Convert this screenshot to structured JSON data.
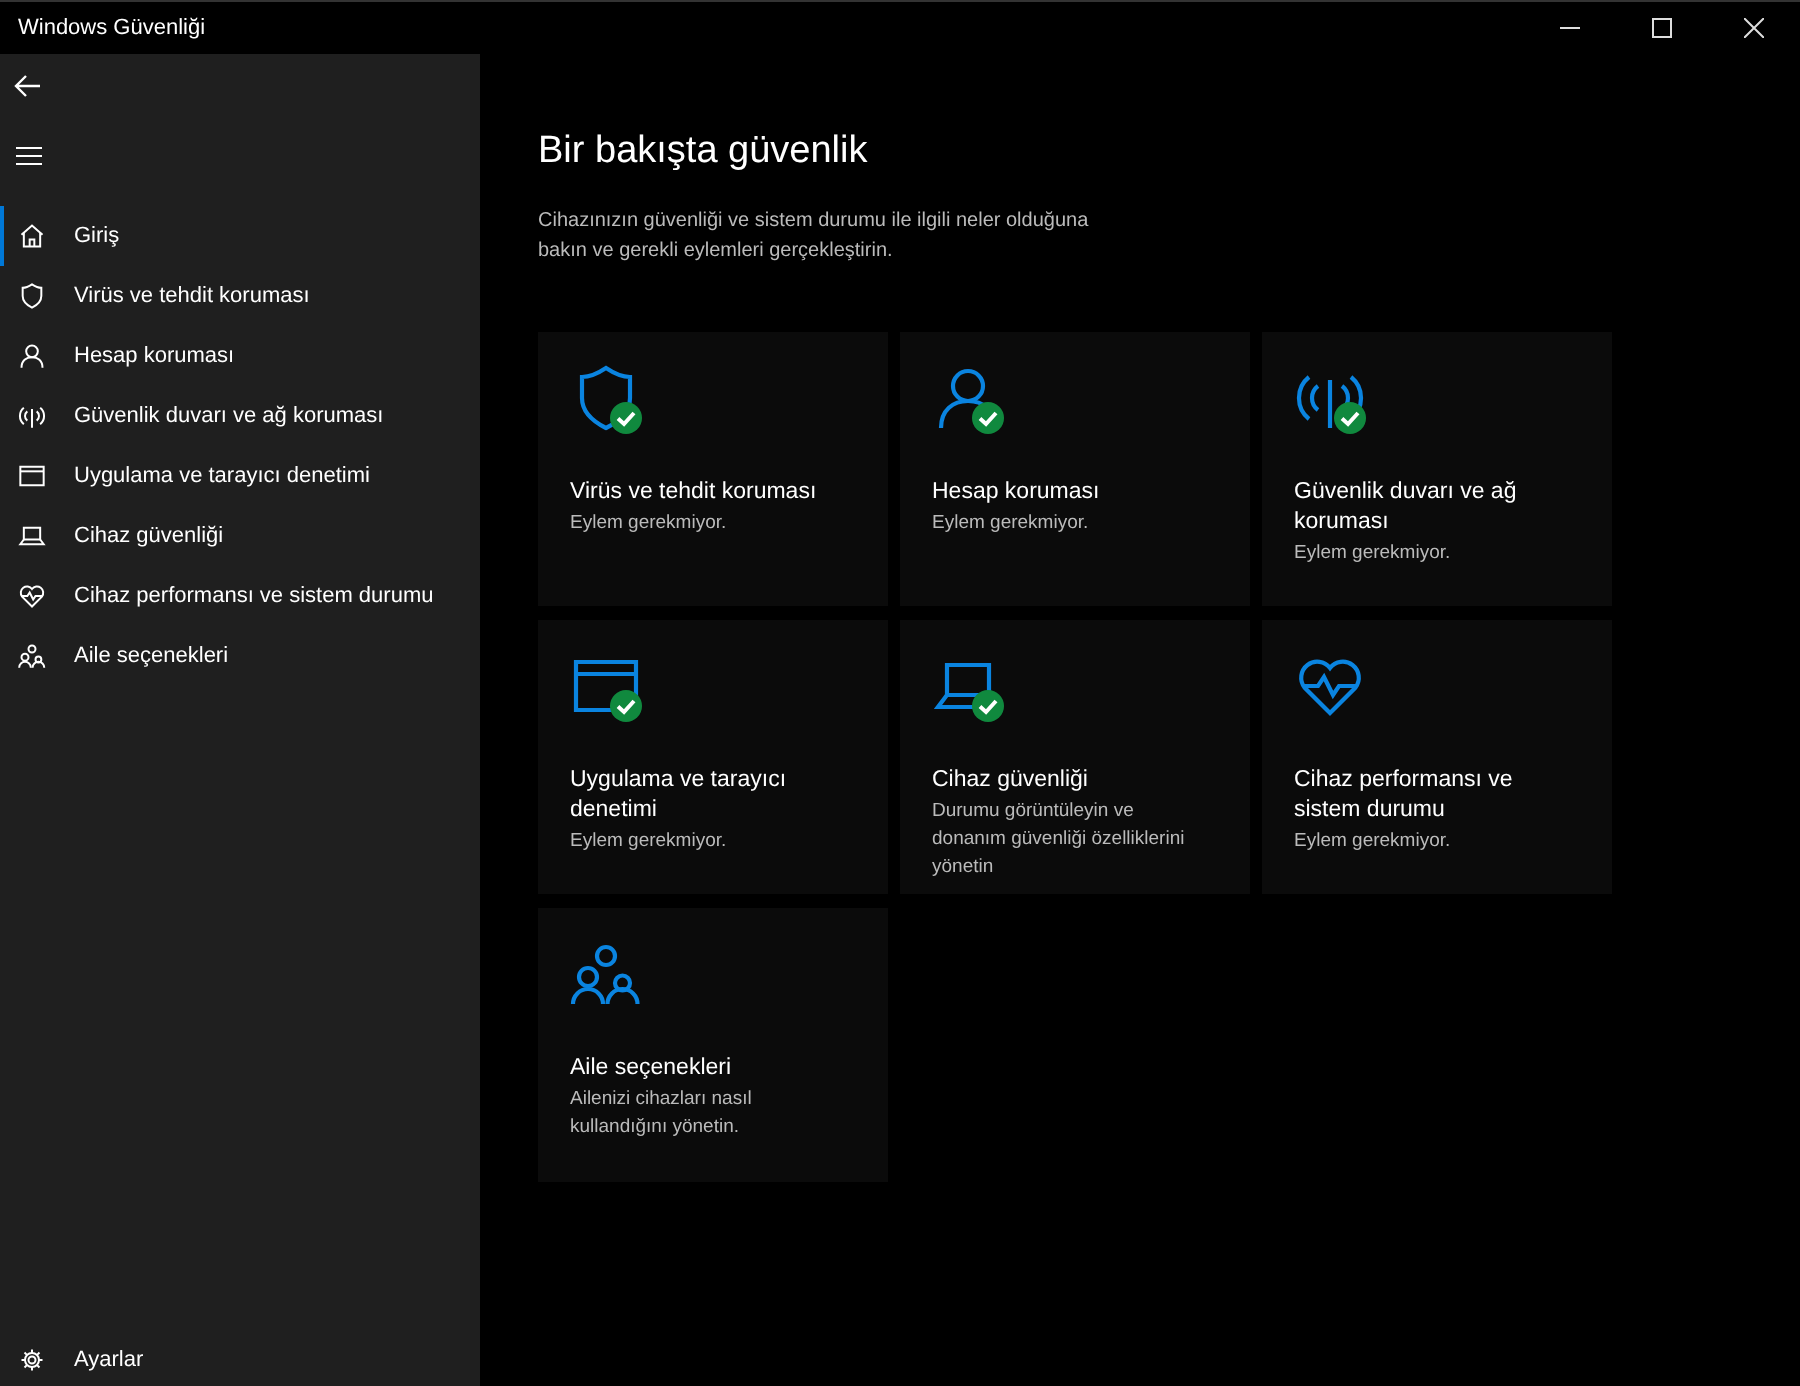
{
  "window": {
    "title": "Windows Güvenliği"
  },
  "sidebar": {
    "items": [
      {
        "label": "Giriş",
        "kind": "home",
        "selected": true
      },
      {
        "label": "Virüs ve tehdit koruması",
        "kind": "shield",
        "selected": false
      },
      {
        "label": "Hesap koruması",
        "kind": "person",
        "selected": false
      },
      {
        "label": "Güvenlik duvarı ve ağ koruması",
        "kind": "antenna",
        "selected": false
      },
      {
        "label": "Uygulama ve tarayıcı denetimi",
        "kind": "window",
        "selected": false
      },
      {
        "label": "Cihaz güvenliği",
        "kind": "laptop",
        "selected": false
      },
      {
        "label": "Cihaz performansı ve sistem durumu",
        "kind": "heart",
        "selected": false
      },
      {
        "label": "Aile seçenekleri",
        "kind": "family",
        "selected": false
      }
    ],
    "footer": {
      "label": "Ayarlar",
      "kind": "gear"
    }
  },
  "main": {
    "title": "Bir bakışta güvenlik",
    "description": "Cihazınızın güvenliği ve sistem durumu ile ilgili neler olduğuna bakın ve gerekli eylemleri gerçekleştirin.",
    "cards": [
      {
        "kind": "shield",
        "ok": true,
        "title": "Virüs ve tehdit koruması",
        "subtitle": "Eylem gerekmiyor."
      },
      {
        "kind": "person",
        "ok": true,
        "title": "Hesap koruması",
        "subtitle": "Eylem gerekmiyor."
      },
      {
        "kind": "antenna",
        "ok": true,
        "title": "Güvenlik duvarı ve ağ koruması",
        "subtitle": "Eylem gerekmiyor."
      },
      {
        "kind": "window",
        "ok": true,
        "title": "Uygulama ve tarayıcı denetimi",
        "subtitle": "Eylem gerekmiyor."
      },
      {
        "kind": "laptop",
        "ok": true,
        "title": "Cihaz güvenliği",
        "subtitle": "Durumu görüntüleyin ve donanım güvenliği özelliklerini yönetin"
      },
      {
        "kind": "heart",
        "ok": false,
        "title": "Cihaz performansı ve sistem durumu",
        "subtitle": "Eylem gerekmiyor."
      },
      {
        "kind": "family",
        "ok": false,
        "title": "Aile seçenekleri",
        "subtitle": "Ailenizi cihazları nasıl kullandığını yönetin."
      }
    ]
  }
}
